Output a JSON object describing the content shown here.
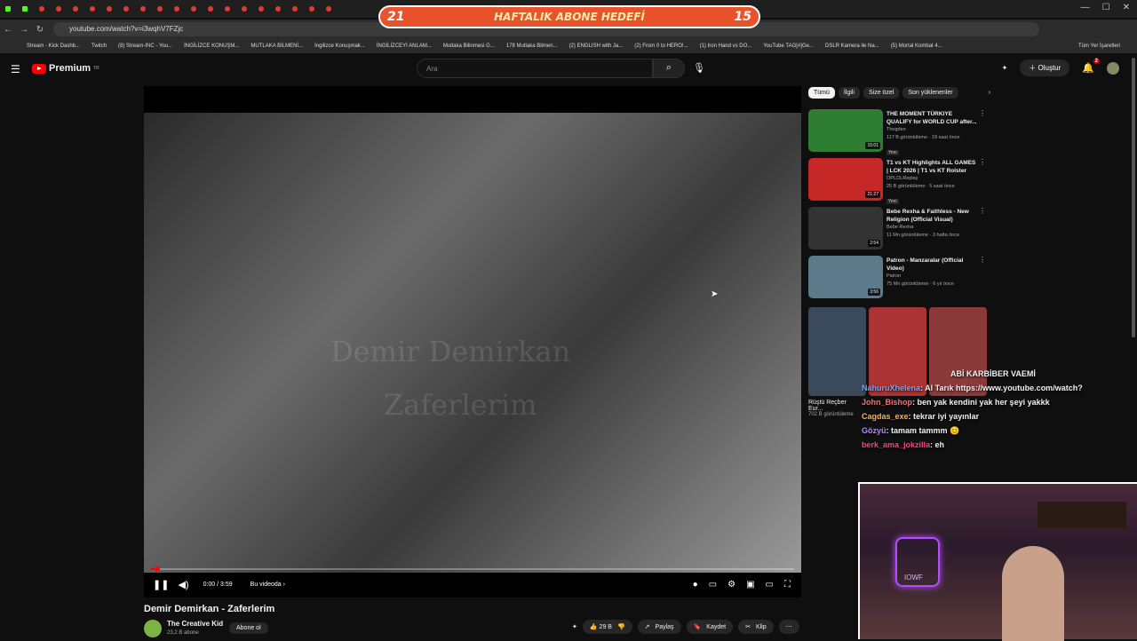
{
  "browser": {
    "url": "youtube.com/watch?v=i3wqhV7FZjc",
    "goal_left": "21",
    "goal_title": "HAFTALIK ABONE HEDEFİ",
    "goal_right": "15",
    "bookmarks": [
      "Stream - Kick Dashb...",
      "Twitch",
      "(8) Stream-INC - You...",
      "İNGİLİZCE KONUŞM...",
      "MUTLAKA BİLMENİ...",
      "İngilizce Konuşmak...",
      "İNGİLİZCEYİ ANLAM...",
      "Mutlaka Bilinmesi G...",
      "178 Mutlaka Bilmen...",
      "(2) ENGLISH with Ja...",
      "(2) From 0 to HERO!...",
      "(1) Iron Hand vs DO...",
      "YouTube TAG[#]Ge...",
      "DSLR Kamera ile Na...",
      "(5) Mortal Kombat 4..."
    ],
    "bookmarks_right": "Tüm Yer İşaretleri"
  },
  "yt": {
    "premium": "Premium",
    "tm": "TR",
    "search_placeholder": "Ara",
    "create": "Oluştur",
    "bell_count": "2"
  },
  "player": {
    "time": "0:00 / 3:59",
    "chapter": "Bu videoda",
    "watermark1": "Demir Demirkan",
    "watermark2": "Zaferlerim"
  },
  "video": {
    "title": "Demir Demirkan - Zaferlerim",
    "channel": "The Creative Kid",
    "subs": "23,2 B abone",
    "subscribe": "Abone ol",
    "likes": "29 B",
    "share": "Paylaş",
    "save": "Kaydet",
    "clip": "Klip"
  },
  "chips": [
    "Tümü",
    "İlgili",
    "Size özel",
    "Son yüklenenler"
  ],
  "recs": [
    {
      "title": "THE MOMENT TÜRKIYE QUALIFY for WORLD CUP after...",
      "channel": "Thogden",
      "meta": "117 B görüntüleme · 19 saat önce",
      "badge": "Yeni",
      "dur": "15:01",
      "color": "#2e7d32"
    },
    {
      "title": "T1 vs KT Highlights ALL GAMES | LCK 2026 | T1 vs KT Rolster",
      "channel": "OPLOLReplay",
      "meta": "25 B görüntüleme · 5 saat önce",
      "badge": "Yeni",
      "dur": "21:27",
      "color": "#c62828"
    },
    {
      "title": "Bebe Rexha & Faithless - New Religion (Official Visual)",
      "channel": "Bebe Rexha",
      "meta": "11 Mn görüntüleme · 3 hafta önce",
      "badge": "",
      "dur": "2:54",
      "color": "#333"
    },
    {
      "title": "Patron - Manzaralar (Official Video)",
      "channel": "Patron",
      "meta": "75 Mn görüntüleme · 6 yıl önce",
      "badge": "",
      "dur": "3:56",
      "color": "#5d7a8a"
    }
  ],
  "shorts_left": {
    "title": "Rüştü Reçber Eur...",
    "meta": "702 B görüntüleme"
  },
  "chat": [
    {
      "user": "",
      "msg": "ABİ KARBİBER VAEMİ",
      "ucolor": "#ffffff"
    },
    {
      "user": "NahuruXhelena",
      "msg": ": Al Tarık https://www.youtube.com/watch?",
      "ucolor": "#6fa8ff"
    },
    {
      "user": "John_Bishop",
      "msg": ": ben yak kendini yak her şeyi yakkk",
      "ucolor": "#ff6b6b"
    },
    {
      "user": "Cagdas_exe",
      "msg": ": tekrar iyi yayınlar",
      "ucolor": "#ffb347"
    },
    {
      "user": "Gözyü",
      "msg": ": tamam tammm 😊",
      "ucolor": "#b388ff"
    },
    {
      "user": "berk_ama_jokzilla",
      "msg": ": eh",
      "ucolor": "#ff4081"
    }
  ],
  "cam": {
    "neon": "IOWF"
  }
}
